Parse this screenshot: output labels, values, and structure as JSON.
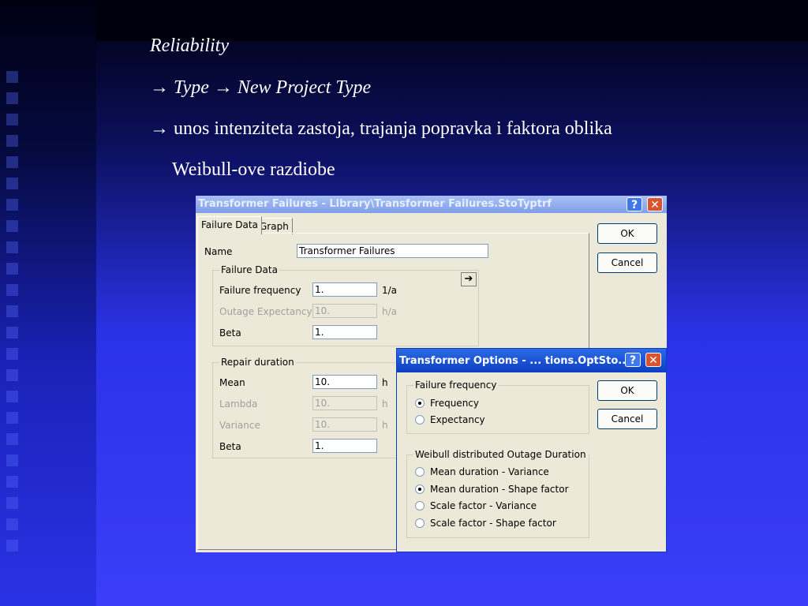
{
  "slide": {
    "line1": "Reliability",
    "line2": "→ Type → New Project Type",
    "line3": "→ unos intenziteta zastoja, trajanja popravka i faktora oblika",
    "line4": "Weibull-ove razdiobe"
  },
  "main_dialog": {
    "title": "Transformer Failures - Library\\Transformer Failures.StoTyptrf",
    "tabs": [
      "Failure Data",
      "Graph"
    ],
    "name_label": "Name",
    "name_value": "Transformer Failures",
    "failure_group": "Failure Data",
    "failure_rows": [
      {
        "label": "Failure frequency",
        "value": "1.",
        "unit": "1/a"
      },
      {
        "label": "Outage Expectancy",
        "value": "10.",
        "unit": "h/a"
      },
      {
        "label": "Beta",
        "value": "1.",
        "unit": ""
      }
    ],
    "repair_group": "Repair duration",
    "repair_rows": [
      {
        "label": "Mean",
        "value": "10.",
        "unit": "h"
      },
      {
        "label": "Lambda",
        "value": "10.",
        "unit": "h"
      },
      {
        "label": "Variance",
        "value": "10.",
        "unit": "h"
      },
      {
        "label": "Beta",
        "value": "1.",
        "unit": ""
      }
    ],
    "ok": "OK",
    "cancel": "Cancel",
    "help_glyph": "?",
    "close_glyph": "✕",
    "arrow_glyph": "➔"
  },
  "options_dialog": {
    "title": "Transformer Options - ... tions.OptSto...",
    "freq_group": "Failure frequency",
    "freq_options": [
      "Frequency",
      "Expectancy"
    ],
    "freq_selected": 0,
    "weibull_group": "Weibull distributed Outage Duration",
    "weibull_options": [
      "Mean duration - Variance",
      "Mean duration - Shape factor",
      "Scale factor - Variance",
      "Scale factor - Shape factor"
    ],
    "weibull_selected": 1,
    "ok": "OK",
    "cancel": "Cancel",
    "help_glyph": "?",
    "close_glyph": "✕"
  }
}
